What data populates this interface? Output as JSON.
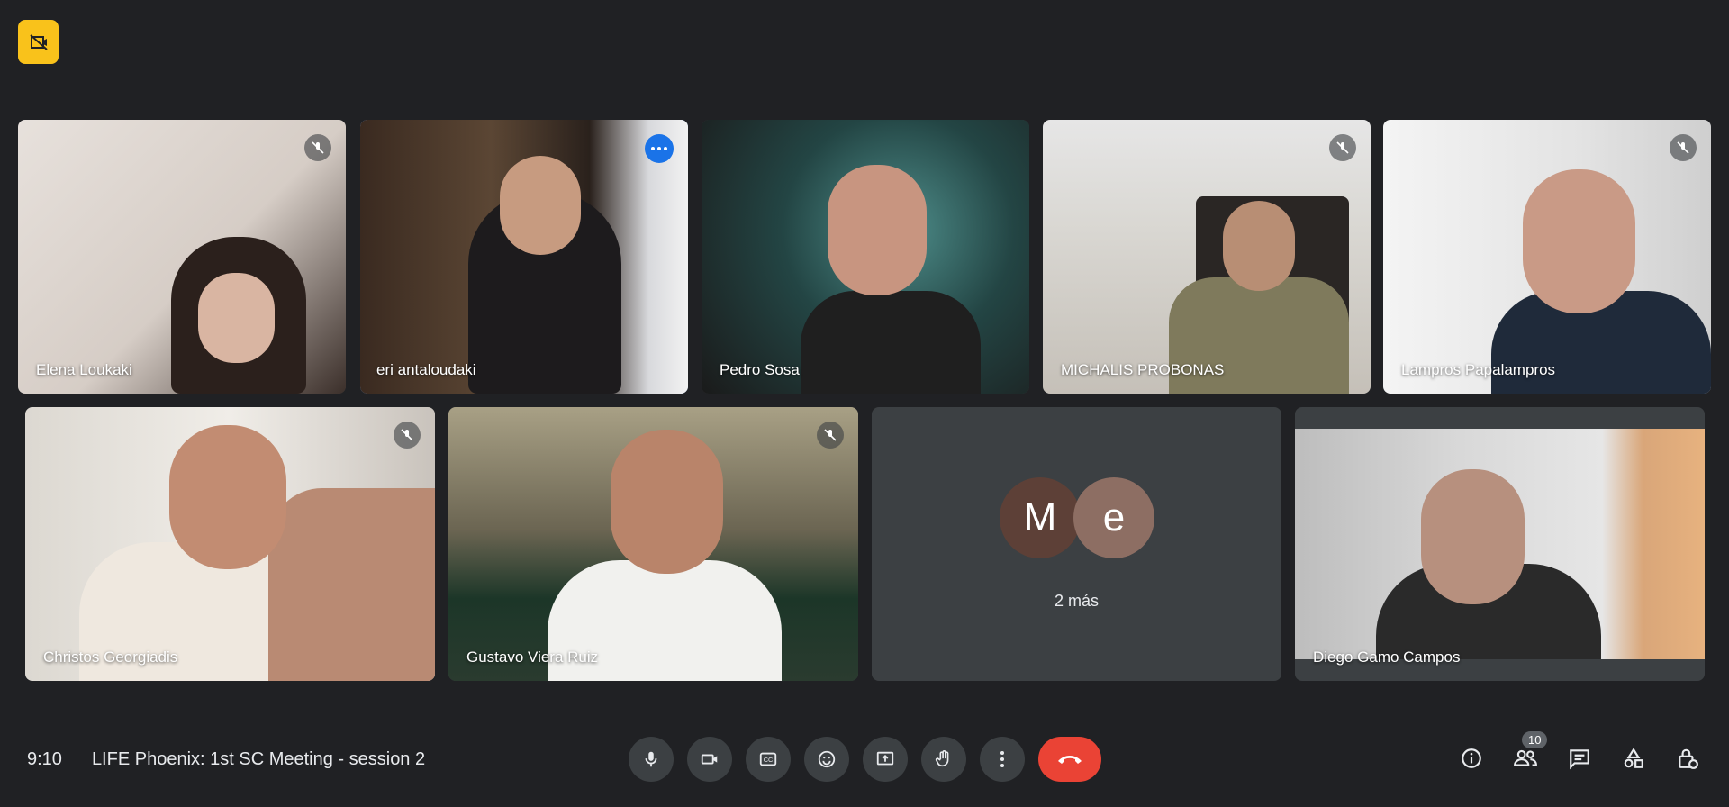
{
  "participants": [
    {
      "name": "Elena Loukaki",
      "muted": true
    },
    {
      "name": "eri antaloudaki",
      "muted": false
    },
    {
      "name": "Pedro Sosa",
      "muted": false
    },
    {
      "name": "MICHALIS PROBONAS",
      "muted": true
    },
    {
      "name": "Lampros Papalampros",
      "muted": true
    },
    {
      "name": "Christos Georgiadis",
      "muted": true
    },
    {
      "name": "Gustavo Viera Ruiz",
      "muted": true
    },
    {
      "name": "Diego Gamo Campos",
      "muted": false
    }
  ],
  "more_tile": {
    "avatars": [
      {
        "letter": "M",
        "color": "#5d4037"
      },
      {
        "letter": "e",
        "color": "#8d6e63"
      }
    ],
    "label": "2 más"
  },
  "meeting": {
    "time": "9:10",
    "title": "LIFE Phoenix: 1st SC Meeting - session 2"
  },
  "controls": [
    "microphone-icon",
    "camera-icon",
    "captions-icon",
    "emoji-icon",
    "present-icon",
    "raise-hand-icon",
    "more-options-icon",
    "end-call-icon"
  ],
  "right_controls": {
    "people_count": "10",
    "icons": [
      "info-icon",
      "people-icon",
      "chat-icon",
      "activities-icon",
      "host-controls-icon"
    ]
  },
  "colors": {
    "background": "#202124",
    "tile": "#3c4043",
    "active_border": "#8ab4f8",
    "end_call": "#ea4335",
    "badge": "#f9c21b"
  }
}
